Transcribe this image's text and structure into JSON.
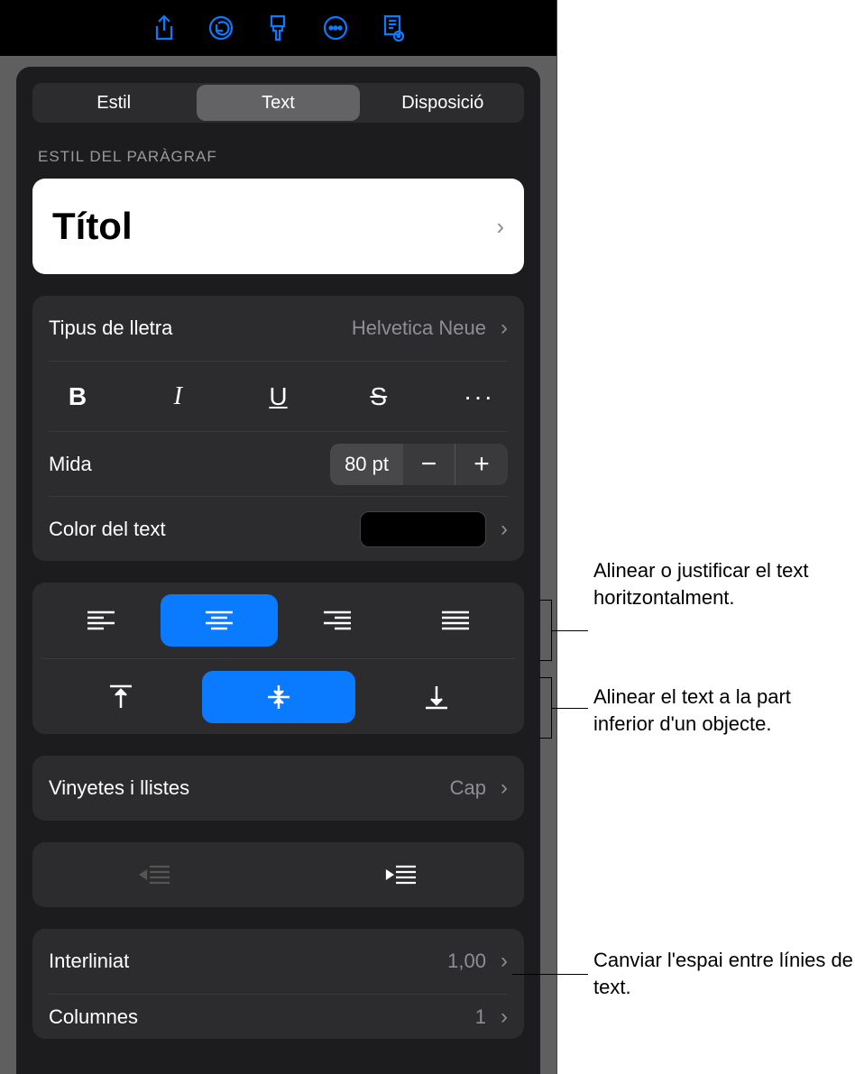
{
  "toolbar": {
    "icons": [
      "share",
      "undo",
      "format-brush",
      "more",
      "document"
    ]
  },
  "tabs": {
    "items": [
      "Estil",
      "Text",
      "Disposició"
    ],
    "active": 1
  },
  "section_label": "Estil del paràgraf",
  "paragraph_style": "Títol",
  "font": {
    "label": "Tipus de lletra",
    "value": "Helvetica Neue"
  },
  "size": {
    "label": "Mida",
    "value": "80 pt"
  },
  "text_color": {
    "label": "Color del text",
    "swatch": "#000000"
  },
  "bullets": {
    "label": "Vinyetes i llistes",
    "value": "Cap"
  },
  "line_spacing": {
    "label": "Interliniat",
    "value": "1,00"
  },
  "columns": {
    "label": "Columnes",
    "value": "1"
  },
  "horizontal_alignment": {
    "active": 1
  },
  "vertical_alignment": {
    "active": 1
  },
  "style_buttons": {
    "bold": "B",
    "italic": "I",
    "underline": "U",
    "strike": "S",
    "more": "···"
  },
  "callouts": {
    "halign": "Alinear o justificar el text horitzontalment.",
    "valign": "Alinear el text a la part inferior d'un objecte.",
    "spacing": "Canviar l'espai entre línies de text."
  }
}
